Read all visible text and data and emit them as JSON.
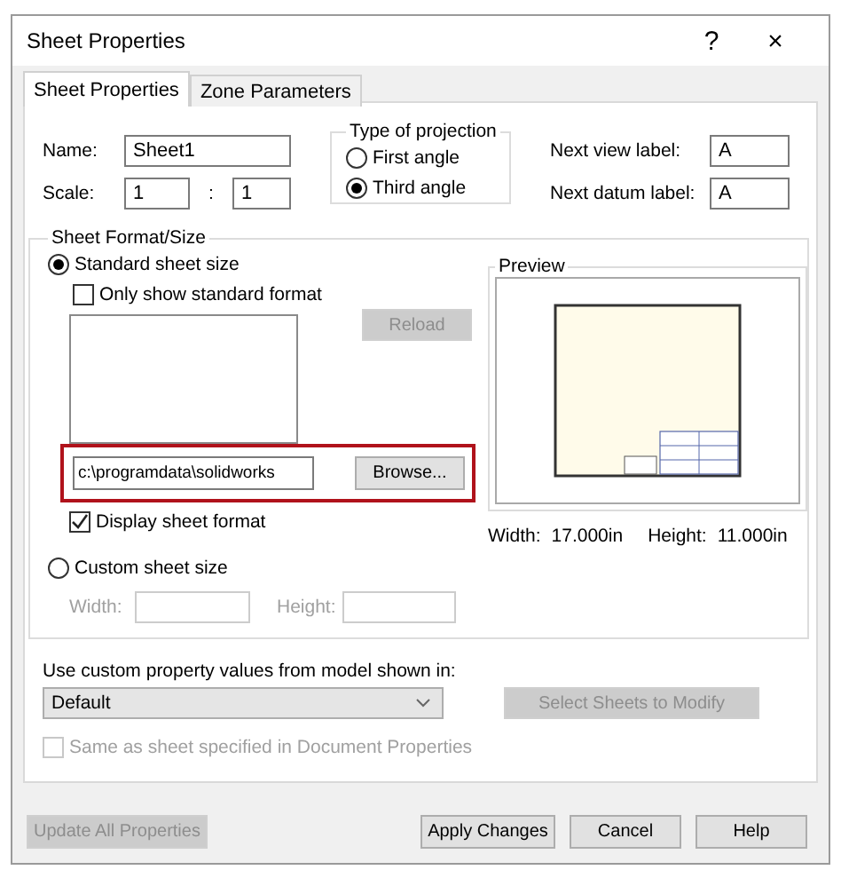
{
  "window": {
    "title": "Sheet Properties",
    "help": "?",
    "close": "×"
  },
  "tabs": [
    {
      "label": "Sheet Properties",
      "selected": true
    },
    {
      "label": "Zone Parameters",
      "selected": false
    }
  ],
  "name": {
    "label": "Name:",
    "value": "Sheet1"
  },
  "scale": {
    "label": "Scale:",
    "value_1": "1",
    "separator": ":",
    "value_2": "1"
  },
  "projection": {
    "title": "Type of projection",
    "options": [
      {
        "label": "First angle",
        "selected": false
      },
      {
        "label": "Third angle",
        "selected": true
      }
    ]
  },
  "next_view_label": {
    "label": "Next view label:",
    "value": "A"
  },
  "next_datum_label": {
    "label": "Next datum label:",
    "value": "A"
  },
  "sheet_format": {
    "title": "Sheet Format/Size",
    "standard": {
      "label": "Standard sheet size",
      "selected": true
    },
    "only_standard": {
      "label": "Only show standard format",
      "checked": false
    },
    "reload": {
      "label": "Reload",
      "disabled": true
    },
    "format_path": "c:\\programdata\\solidworks",
    "browse": "Browse...",
    "display_format": {
      "label": "Display sheet format",
      "checked": true
    },
    "custom": {
      "label": "Custom sheet size",
      "selected": false
    },
    "width": {
      "label": "Width:",
      "disabled": true
    },
    "height": {
      "label": "Height:",
      "disabled": true
    },
    "preview": {
      "title": "Preview",
      "width_label": "Width:",
      "width_value": "17.000in",
      "height_label": "Height:",
      "height_value": "11.000in"
    }
  },
  "custom_property": {
    "label": "Use custom property values from model shown in:",
    "value": "Default"
  },
  "select_sheets": {
    "label": "Select Sheets to Modify",
    "disabled": true
  },
  "same_as_sheet": {
    "label": "Same as sheet specified in Document Properties",
    "checked": false,
    "disabled": true
  },
  "buttons": [
    {
      "label": "Update All Properties",
      "disabled": true
    },
    {
      "label": "Apply Changes",
      "disabled": false
    },
    {
      "label": "Cancel",
      "disabled": false
    },
    {
      "label": "Help",
      "disabled": false
    }
  ]
}
